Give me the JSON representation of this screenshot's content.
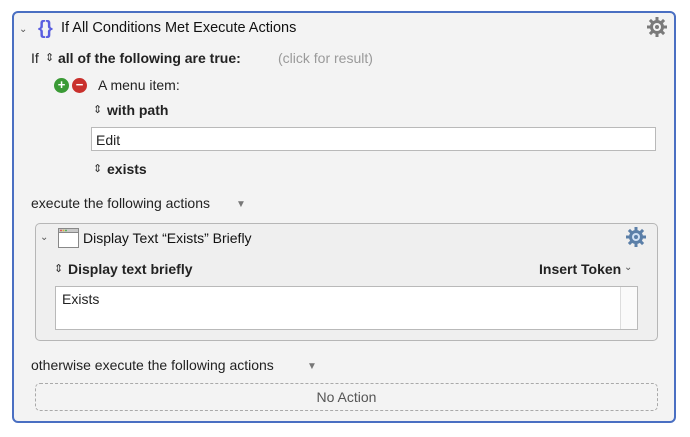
{
  "header": {
    "title": "If All Conditions Met Execute Actions",
    "braces": "{}"
  },
  "condition": {
    "if_label": "If",
    "mode": "all of the following are true:",
    "result_hint": "(click for result)",
    "item_label": "A menu item:",
    "path_option": "with path",
    "path_value": "Edit",
    "state_option": "exists"
  },
  "execute": {
    "label": "execute the following actions",
    "action": {
      "title": "Display Text “Exists” Briefly",
      "display_option": "Display text briefly",
      "insert_token": "Insert Token",
      "text": "Exists"
    }
  },
  "otherwise": {
    "label": "otherwise execute the following actions",
    "empty": "No Action"
  },
  "colors": {
    "accent_border": "#4a6fc2",
    "brace": "#5a5ee0",
    "plus": "#3a9a35",
    "minus": "#c9302c"
  }
}
